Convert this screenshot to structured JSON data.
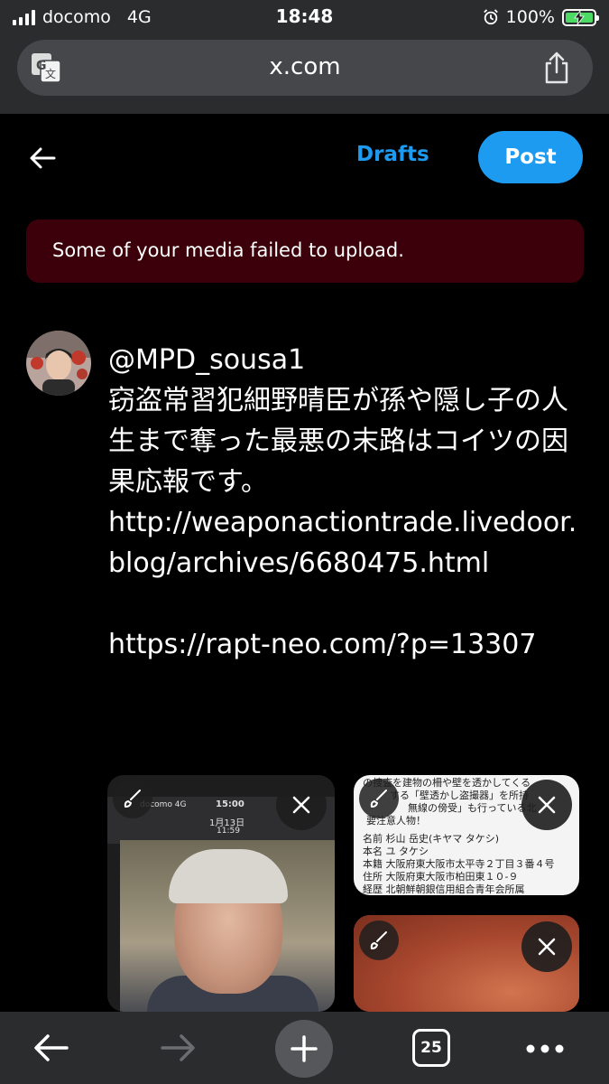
{
  "status_bar": {
    "carrier": "docomo",
    "network": "4G",
    "time": "18:48",
    "battery_percent": "100%"
  },
  "browser": {
    "url": "x.com",
    "translate_icon": "translate-icon",
    "share_icon": "share-icon"
  },
  "compose": {
    "drafts_label": "Drafts",
    "post_label": "Post",
    "accent_color": "#1d9bf0"
  },
  "error": {
    "message": "Some of your media failed to upload.",
    "background": "#3b0009"
  },
  "tweet": {
    "text": "@MPD_sousa1\n窃盗常習犯細野晴臣が孫や隠し子の人生まで奪った最悪の末路はコイツの因果応報です。\nhttp://weaponactiontrade.livedoor.blog/archives/6680475.html\n\nhttps://rapt-neo.com/?p=13307"
  },
  "media": [
    {
      "kind": "phone-screenshot",
      "lines": [
        "docomo 4G",
        "15:00",
        "1月13日",
        "11:59"
      ]
    },
    {
      "kind": "document",
      "lines": [
        "の捜査を建物の柵や壁を透かしてくる",
        "する「壁透かし盗撮器」を所持",
        "無線の傍受」も行っている北",
        "要注意人物！",
        "名前 杉山 岳史(キヤマ タケシ)",
        "本名 ユ タケシ",
        "本籍 大阪府東大阪市太平寺２丁目３番４号",
        "住所 大阪府東大阪市柏田東１０-９",
        "経歴 北朝鮮朝銀信用組合青年会所属"
      ]
    },
    {
      "kind": "photo"
    }
  ],
  "toolbar": {
    "tab_count": "25"
  }
}
